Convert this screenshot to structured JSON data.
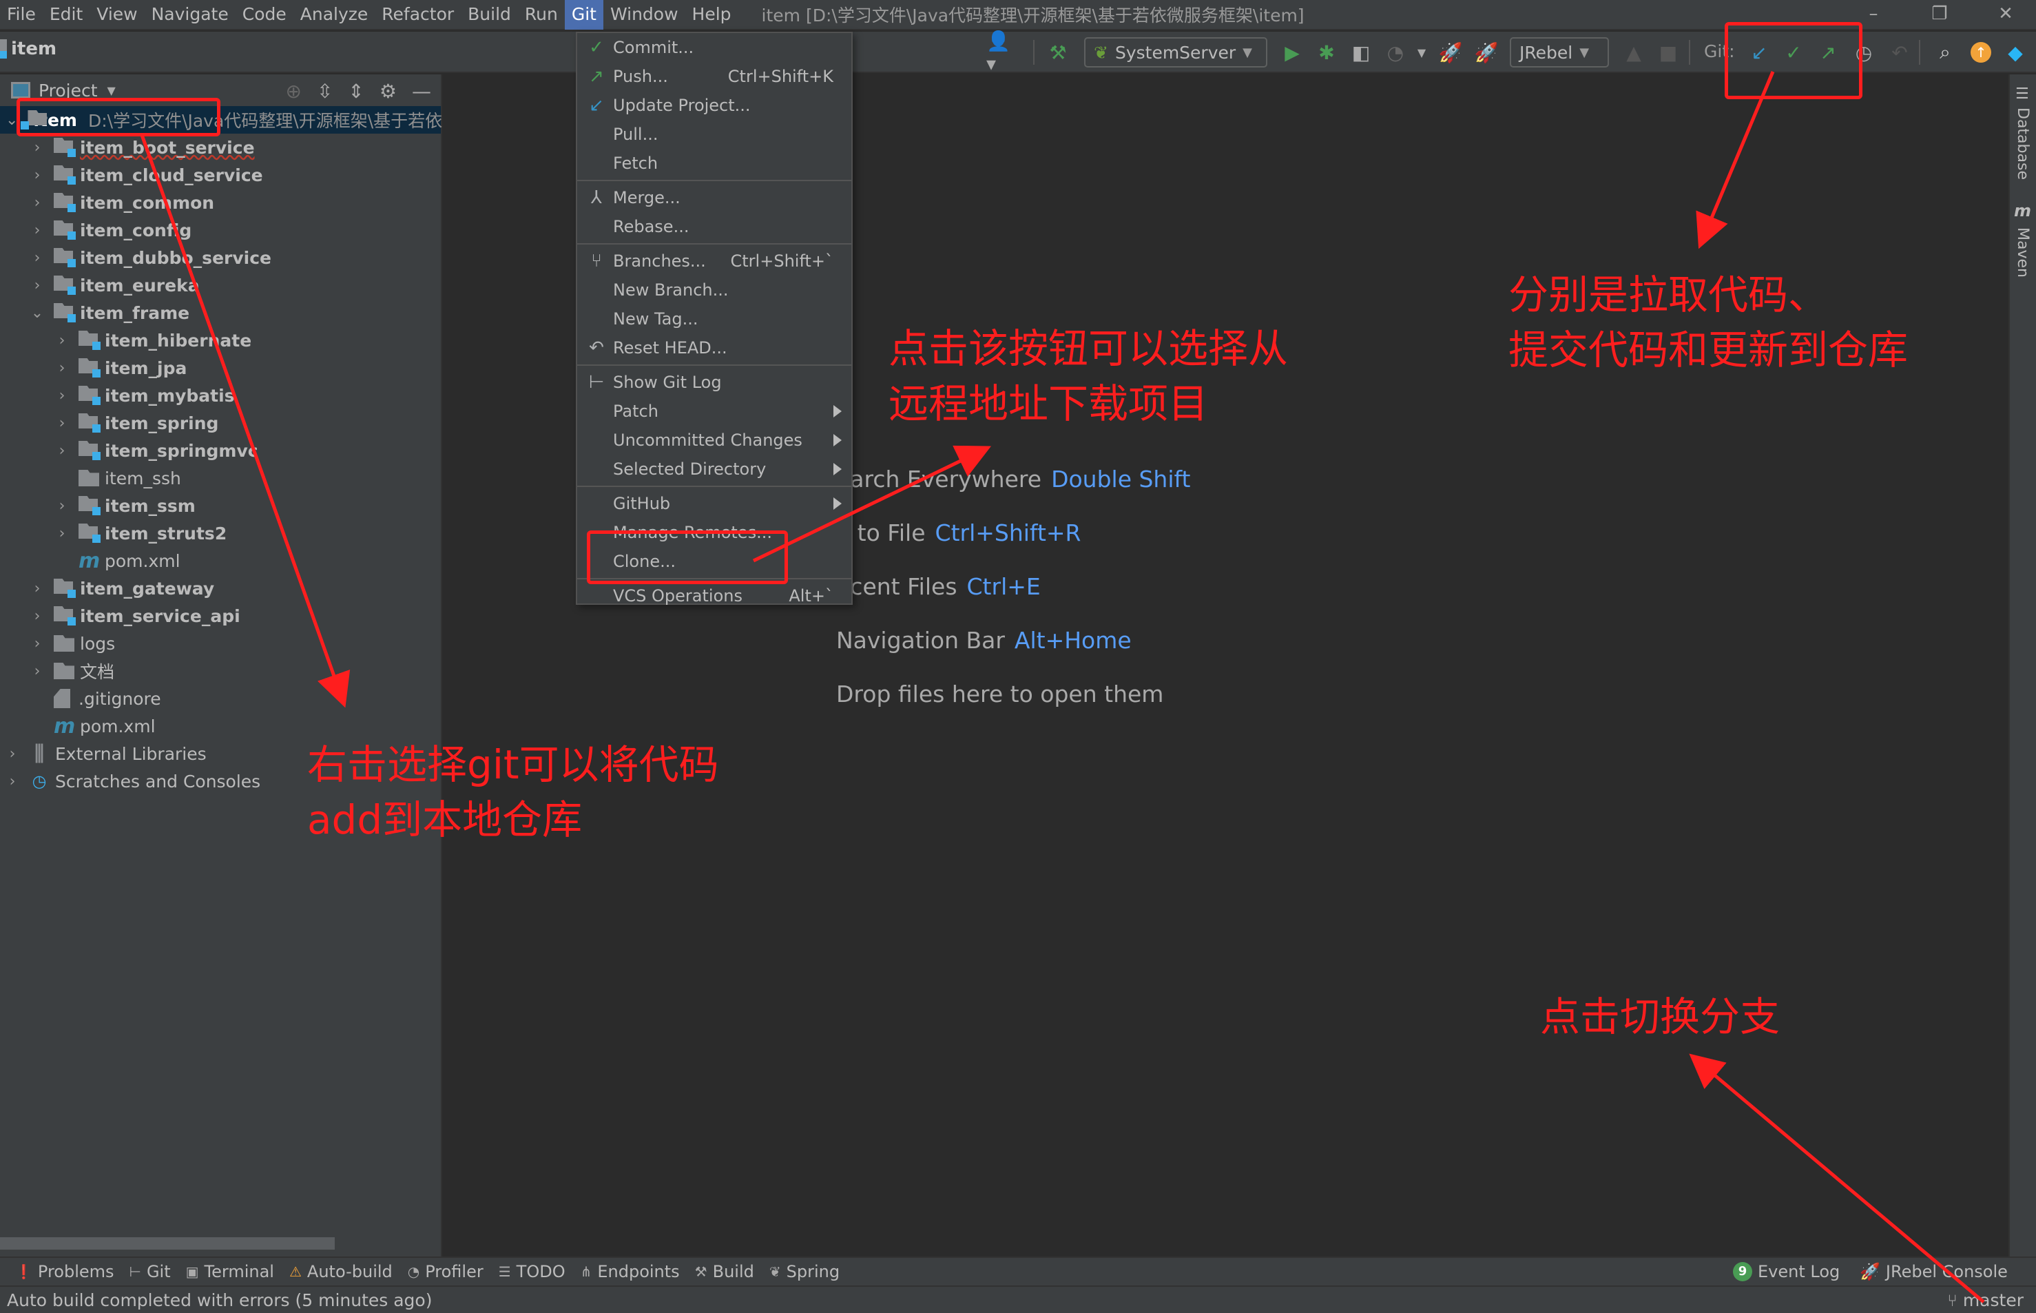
{
  "menubar": {
    "items": [
      "File",
      "Edit",
      "View",
      "Navigate",
      "Code",
      "Analyze",
      "Refactor",
      "Build",
      "Run",
      "Git",
      "Window",
      "Help"
    ],
    "active": "Git",
    "window_title": "item [D:\\学习文件\\Java代码整理\\开源框架\\基于若依微服务框架\\item]",
    "window_controls": {
      "minimize": "–",
      "restore": "❐",
      "close": "✕"
    }
  },
  "toolbar": {
    "breadcrumb": "item",
    "run_config": "SystemServer",
    "jrebel_config": "JRebel",
    "git_label": "Git:",
    "icons": [
      "user-icon",
      "build-hammer-icon",
      "run-icon",
      "debug-icon",
      "coverage-icon",
      "profiler-icon",
      "jrebel-run-icon",
      "jrebel-debug-icon",
      "stop-icon",
      "update-project-icon",
      "commit-icon",
      "push-icon",
      "history-icon",
      "rollback-icon",
      "search-icon",
      "update-available-icon",
      "toolbox-icon"
    ]
  },
  "project_panel": {
    "title": "Project",
    "root": {
      "name": "item",
      "path": "D:\\学习文件\\Java代码整理\\开源框架\\基于若依"
    },
    "rows": [
      {
        "label": "item_boot_service",
        "indent": 1,
        "type": "module",
        "expand": "collapsed",
        "bold": true
      },
      {
        "label": "item_cloud_service",
        "indent": 1,
        "type": "module",
        "expand": "collapsed",
        "bold": true
      },
      {
        "label": "item_common",
        "indent": 1,
        "type": "module",
        "expand": "collapsed",
        "bold": true
      },
      {
        "label": "item_config",
        "indent": 1,
        "type": "module",
        "expand": "collapsed",
        "bold": true
      },
      {
        "label": "item_dubbo_service",
        "indent": 1,
        "type": "module",
        "expand": "collapsed",
        "bold": true
      },
      {
        "label": "item_eureka",
        "indent": 1,
        "type": "module",
        "expand": "collapsed",
        "bold": true
      },
      {
        "label": "item_frame",
        "indent": 1,
        "type": "module",
        "expand": "expanded",
        "bold": true
      },
      {
        "label": "item_hibernate",
        "indent": 2,
        "type": "module",
        "expand": "collapsed",
        "bold": true
      },
      {
        "label": "item_jpa",
        "indent": 2,
        "type": "module",
        "expand": "collapsed",
        "bold": true
      },
      {
        "label": "item_mybatis",
        "indent": 2,
        "type": "module",
        "expand": "collapsed",
        "bold": true
      },
      {
        "label": "item_spring",
        "indent": 2,
        "type": "module",
        "expand": "collapsed",
        "bold": true
      },
      {
        "label": "item_springmvc",
        "indent": 2,
        "type": "module",
        "expand": "collapsed",
        "bold": true
      },
      {
        "label": "item_ssh",
        "indent": 2,
        "type": "folder",
        "expand": "none",
        "bold": false
      },
      {
        "label": "item_ssm",
        "indent": 2,
        "type": "module",
        "expand": "collapsed",
        "bold": true
      },
      {
        "label": "item_struts2",
        "indent": 2,
        "type": "module",
        "expand": "collapsed",
        "bold": true
      },
      {
        "label": "pom.xml",
        "indent": 2,
        "type": "maven",
        "expand": "none",
        "bold": false
      },
      {
        "label": "item_gateway",
        "indent": 1,
        "type": "module",
        "expand": "collapsed",
        "bold": true
      },
      {
        "label": "item_service_api",
        "indent": 1,
        "type": "module",
        "expand": "collapsed",
        "bold": true
      },
      {
        "label": "logs",
        "indent": 1,
        "type": "folder",
        "expand": "collapsed",
        "bold": false
      },
      {
        "label": "文档",
        "indent": 1,
        "type": "folder",
        "expand": "collapsed",
        "bold": false
      },
      {
        "label": ".gitignore",
        "indent": 1,
        "type": "ignore",
        "expand": "none",
        "bold": false
      },
      {
        "label": "pom.xml",
        "indent": 1,
        "type": "maven",
        "expand": "none",
        "bold": false
      },
      {
        "label": "External Libraries",
        "indent": 0,
        "type": "libraries",
        "expand": "collapsed",
        "bold": false
      },
      {
        "label": "Scratches and Consoles",
        "indent": 0,
        "type": "scratches",
        "expand": "collapsed",
        "bold": false
      }
    ]
  },
  "git_menu": {
    "groups": [
      [
        {
          "label": "Commit...",
          "icon": "commit-check-icon",
          "icon_color": "#499c54"
        },
        {
          "label": "Push...",
          "icon": "push-arrow-icon",
          "icon_color": "#499c54",
          "shortcut": "Ctrl+Shift+K"
        },
        {
          "label": "Update Project...",
          "icon": "update-arrow-icon",
          "icon_color": "#3592c4"
        },
        {
          "label": "Pull..."
        },
        {
          "label": "Fetch"
        }
      ],
      [
        {
          "label": "Merge...",
          "icon": "merge-icon",
          "icon_color": "#afb1b3"
        },
        {
          "label": "Rebase..."
        }
      ],
      [
        {
          "label": "Branches...",
          "icon": "branch-icon",
          "icon_color": "#afb1b3",
          "shortcut": "Ctrl+Shift+`"
        },
        {
          "label": "New Branch..."
        },
        {
          "label": "New Tag..."
        },
        {
          "label": "Reset HEAD...",
          "icon": "reset-icon",
          "icon_color": "#afb1b3"
        }
      ],
      [
        {
          "label": "Show Git Log",
          "icon": "git-log-icon",
          "icon_color": "#afb1b3"
        },
        {
          "label": "Patch",
          "submenu": true
        },
        {
          "label": "Uncommitted Changes",
          "submenu": true
        },
        {
          "label": "Selected Directory",
          "submenu": true
        }
      ],
      [
        {
          "label": "GitHub",
          "submenu": true
        },
        {
          "label": "Manage Remotes..."
        },
        {
          "label": "Clone..."
        }
      ],
      [
        {
          "label": "VCS Operations",
          "shortcut": "Alt+`"
        }
      ]
    ]
  },
  "welcome": [
    {
      "text": "earch Everywhere",
      "key": "Double Shift"
    },
    {
      "text": "o to File",
      "key": "Ctrl+Shift+R"
    },
    {
      "text": "ecent Files",
      "key": "Ctrl+E"
    },
    {
      "text": "Navigation Bar",
      "key": "Alt+Home"
    },
    {
      "text": "Drop files here to open them",
      "key": ""
    }
  ],
  "right_strip": {
    "tabs": [
      "Database",
      "Maven"
    ]
  },
  "bottom_tools": [
    {
      "label": "Problems",
      "icon": "problems-icon"
    },
    {
      "label": "Git",
      "icon": "git-icon"
    },
    {
      "label": "Terminal",
      "icon": "terminal-icon"
    },
    {
      "label": "Auto-build",
      "icon": "warning-icon"
    },
    {
      "label": "Profiler",
      "icon": "profiler-icon"
    },
    {
      "label": "TODO",
      "icon": "todo-icon"
    },
    {
      "label": "Endpoints",
      "icon": "endpoints-icon"
    },
    {
      "label": "Build",
      "icon": "build-icon"
    },
    {
      "label": "Spring",
      "icon": "spring-icon"
    }
  ],
  "bottom_right_tools": [
    {
      "label": "Event Log",
      "badge": "9",
      "icon": "event-log-icon"
    },
    {
      "label": "JRebel Console",
      "icon": "jrebel-icon"
    }
  ],
  "status": {
    "message": "Auto build completed with errors (5 minutes ago)",
    "branch": "master"
  },
  "annotations": {
    "color": "#ff1e1e",
    "clone_note": [
      "点击该按钮可以选择从",
      "远程地址下载项目"
    ],
    "git_toolbar_note": [
      "分别是拉取代码、",
      "提交代码和更新到仓库"
    ],
    "add_note": [
      "右击选择git可以将代码",
      "add到本地仓库"
    ],
    "branch_note": [
      "点击切换分支"
    ]
  }
}
